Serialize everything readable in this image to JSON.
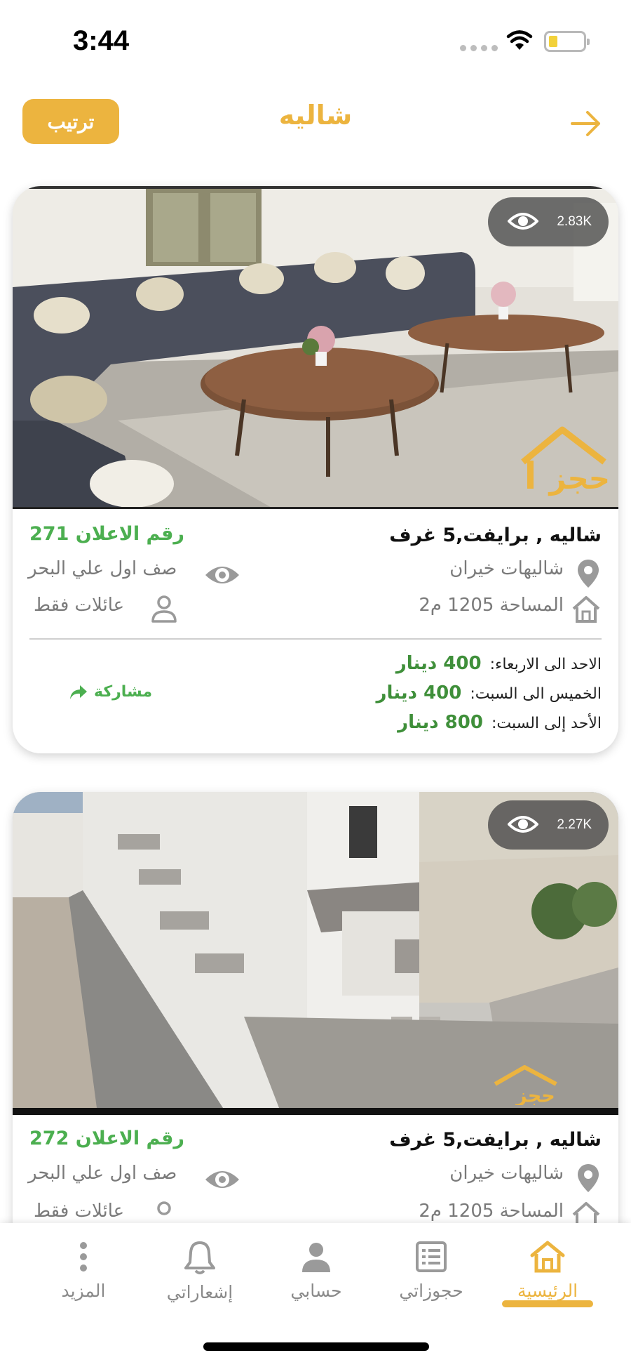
{
  "status_bar": {
    "time": "3:44"
  },
  "header": {
    "title": "شاليه",
    "sort_label": "ترتيب"
  },
  "listings": [
    {
      "views": "2.83K",
      "title": "شاليه , برايفت,5 غرف",
      "ad_number": "رقم الاعلان 271",
      "location": "شاليهات خيران",
      "view_type": "صف اول علي البحر",
      "area": "المساحة 1205 م2",
      "audience": "عائلات فقط",
      "prices": [
        {
          "label": "الاحد الى الاربعاء:",
          "value": "400 دينار"
        },
        {
          "label": "الخميس الى السبت:",
          "value": "400 دينار"
        },
        {
          "label": "الأحد إلى السبت:",
          "value": "800 دينار"
        }
      ],
      "share_label": "مشاركة",
      "watermark": "حجز"
    },
    {
      "views": "2.27K",
      "title": "شاليه , برايفت,5 غرف",
      "ad_number": "رقم الاعلان 272",
      "location": "شاليهات خيران",
      "view_type": "صف اول علي البحر",
      "area": "المساحة 1205 م2",
      "audience": "عائلات فقط",
      "watermark": "حجز"
    }
  ],
  "bottom_nav": {
    "items": [
      {
        "label": "الرئيسية",
        "icon": "home-icon",
        "active": true
      },
      {
        "label": "حجوزاتي",
        "icon": "list-icon",
        "active": false
      },
      {
        "label": "حسابي",
        "icon": "user-icon",
        "active": false
      },
      {
        "label": "إشعاراتي",
        "icon": "bell-icon",
        "active": false
      },
      {
        "label": "المزيد",
        "icon": "more-icon",
        "active": false
      }
    ]
  },
  "colors": {
    "accent": "#ecb43f",
    "green": "#4caf50",
    "price_green": "#3f8f3a"
  }
}
